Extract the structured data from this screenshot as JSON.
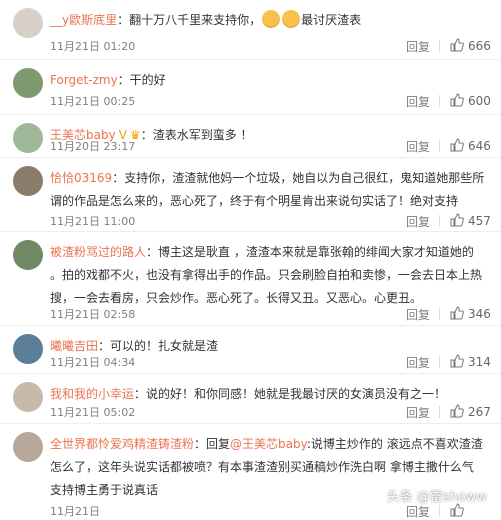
{
  "comments": [
    {
      "user": "__y歐斯底里",
      "text_before": "：翻十万八千里来支持你，",
      "text_after": "最讨厌渣表",
      "emoji_count": 2,
      "badge": "",
      "time": "11月21日 01:20",
      "reply": "回复",
      "likes": "666",
      "avatar_color": "#d7d0c6"
    },
    {
      "user": "Forget-zmy",
      "text_before": "：干的好",
      "text_after": "",
      "emoji_count": 0,
      "badge": "",
      "time": "11月21日 00:25",
      "reply": "回复",
      "likes": "600",
      "avatar_color": "#7e9a6f"
    },
    {
      "user": "王美芯baby",
      "text_before": "：渣表水军到蛮多 ！",
      "text_after": "",
      "emoji_count": 0,
      "badge": "V",
      "time": "11月20日 23:17",
      "reply": "回复",
      "likes": "646",
      "avatar_color": "#9fb89a"
    },
    {
      "user": "恰恰03169",
      "text_before": "：支持你，渣渣就他妈一个垃圾，她自以为自己很红，鬼知道她那些所谓的作品是怎么来的，恶心死了，终于有个明星肯出来说句实话了！绝对支持",
      "text_after": "",
      "emoji_count": 0,
      "badge": "",
      "time": "11月21日 11:00",
      "reply": "回复",
      "likes": "457",
      "avatar_color": "#8a7b6b"
    },
    {
      "user": "被渣粉骂过的路人",
      "text_before": "：博主这是耿直 ，渣渣本来就是靠张翰的绯闻大家才知道她的 。拍的戏都不火，也没有拿得出手的作品。只会刷脸自拍和卖惨，一会去日本上热搜，一会去看房，只会炒作。恶心死了。长得又丑。又恶心。心更丑。",
      "text_after": "",
      "emoji_count": 0,
      "badge": "",
      "time": "11月21日 02:58",
      "reply": "回复",
      "likes": "346",
      "avatar_color": "#6f8a62"
    },
    {
      "user": "曦曦吉田",
      "text_before": "：可以的！扎女就是渣",
      "text_after": "",
      "emoji_count": 0,
      "badge": "",
      "time": "11月21日 04:34",
      "reply": "回复",
      "likes": "314",
      "avatar_color": "#5a7f96"
    },
    {
      "user": "我和我的小幸运",
      "text_before": "：说的好！和你同感！她就是我最讨厌的女演员没有之一！",
      "text_after": "",
      "emoji_count": 0,
      "badge": "",
      "time": "11月21日 05:02",
      "reply": "回复",
      "likes": "267",
      "avatar_color": "#c9b9a8"
    },
    {
      "user": "全世界都怜爱鸡精渣铸渣粉",
      "text_before": "：回复",
      "mention": "@王美芯baby",
      "text_after": ":说博主炒作的 滚远点不喜欢渣渣怎么了，这年头说实话都被喷？有本事渣渣别买通稿炒作洗白啊 拿博主撒什么气 支持博主勇于说真话",
      "emoji_count": 0,
      "badge": "",
      "time": "11月21日 ",
      "reply": "回复",
      "likes": "",
      "avatar_color": "#b7a89a"
    }
  ],
  "watermark": "头条 @雷showw",
  "colors": {
    "username": "#eb7350",
    "meta": "#808080",
    "divider": "#eeeeee"
  }
}
